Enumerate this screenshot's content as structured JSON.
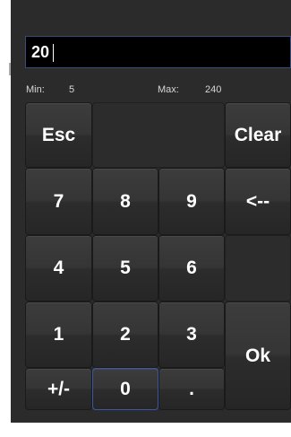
{
  "input": {
    "value": "20"
  },
  "range": {
    "min_label": "Min:",
    "min_value": "5",
    "max_label": "Max:",
    "max_value": "240"
  },
  "keys": {
    "esc": "Esc",
    "clear": "Clear",
    "k7": "7",
    "k8": "8",
    "k9": "9",
    "back": "<--",
    "k4": "4",
    "k5": "5",
    "k6": "6",
    "k1": "1",
    "k2": "2",
    "k3": "3",
    "ok": "Ok",
    "sign": "+/-",
    "k0": "0",
    "dot": "."
  }
}
